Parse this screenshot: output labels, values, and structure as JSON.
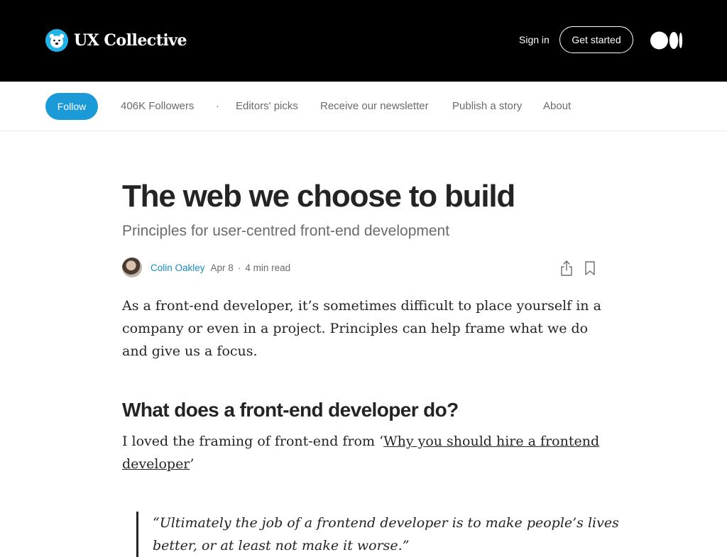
{
  "header": {
    "publication_name": "UX Collective",
    "sign_in_label": "Sign in",
    "get_started_label": "Get started"
  },
  "nav": {
    "follow_label": "Follow",
    "followers": "406K Followers",
    "separator": "·",
    "items": [
      "Editors' picks",
      "Receive our newsletter",
      "Publish a story",
      "About"
    ]
  },
  "article": {
    "title": "The web we choose to build",
    "subtitle": "Principles for user-centred front-end development",
    "author": "Colin Oakley",
    "date": "Apr 8",
    "read_time": "4 min read",
    "dot": "·",
    "paragraph1": "As a front-end developer, it’s sometimes difficult to place yourself in a company or even in a project. Principles can help frame what we do and give us a focus.",
    "heading2": "What does a front-end developer do?",
    "paragraph2_prefix": "I loved the framing of front-end from ‘",
    "paragraph2_link": "Why you should hire a frontend developer",
    "paragraph2_suffix": "’",
    "quote": "“Ultimately the job of a frontend developer is to make people’s lives better, or at least not make it worse.”"
  },
  "icons": {
    "logo": "polar-bear-logo-icon",
    "medium": "medium-logo-icon",
    "share": "share-icon",
    "bookmark": "bookmark-icon"
  },
  "colors": {
    "header_bg": "#000000",
    "accent": "#1a9ad6",
    "author_link": "#1a8bbd",
    "muted_text": "#6b6b6b",
    "body_text": "#242424"
  }
}
